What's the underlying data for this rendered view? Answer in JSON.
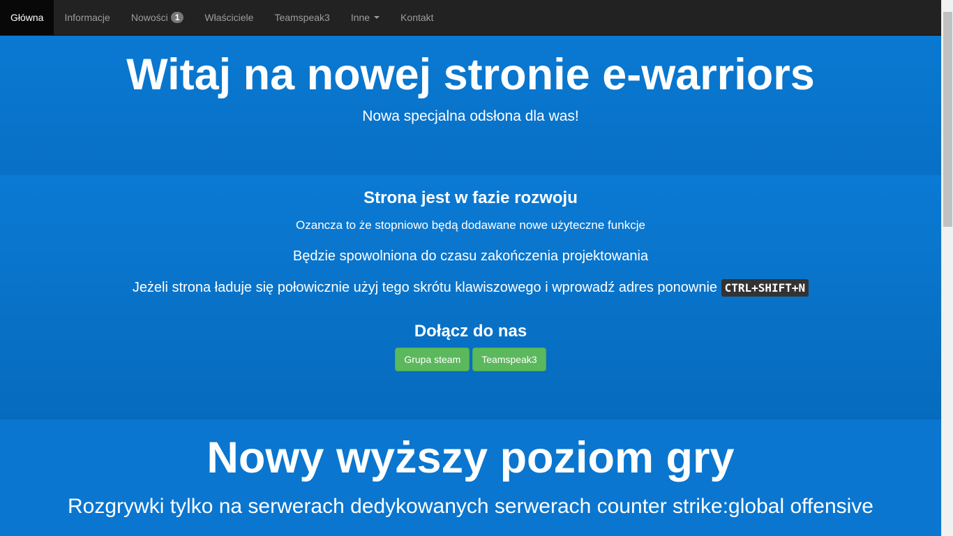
{
  "nav": {
    "items": [
      {
        "label": "Główna"
      },
      {
        "label": "Informacje"
      },
      {
        "label": "Nowości",
        "badge": "1"
      },
      {
        "label": "Właściciele"
      },
      {
        "label": "Teamspeak3"
      },
      {
        "label": "Inne"
      },
      {
        "label": "Kontakt"
      }
    ]
  },
  "hero": {
    "title": "Witaj na nowej stronie e-warriors",
    "subtitle": "Nowa specjalna odsłona dla was!"
  },
  "info": {
    "heading": "Strona jest w fazie rozwoju",
    "line1": "Ozancza to że stopniowo będą dodawane nowe użyteczne funkcje",
    "line2": "Będzie spowolniona do czasu zakończenia projektowania",
    "line3": "Jeżeli strona ładuje się połowicznie użyj tego skrótu klawiszowego i wprowadź adres ponownie",
    "shortcut": "CTRL+SHIFT+N",
    "join_heading": "Dołącz do nas",
    "btn_steam": "Grupa steam",
    "btn_ts": "Teamspeak3"
  },
  "promo": {
    "title": "Nowy wyższy poziom gry",
    "subtitle": "Rozgrywki tylko na serwerach dedykowanych serwerach counter strike:global offensive"
  },
  "colors": {
    "navbar": "#222222",
    "background": "#0a73cc",
    "button": "#5cb85c"
  }
}
